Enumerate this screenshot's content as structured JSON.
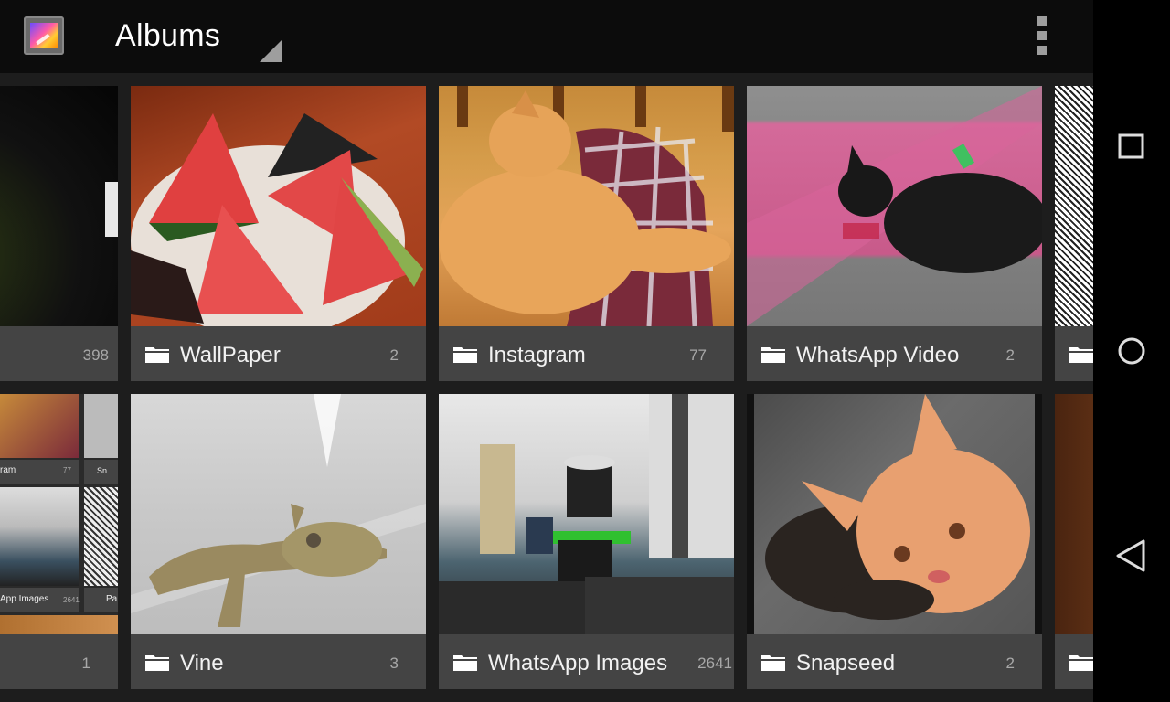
{
  "appbar": {
    "app_icon": "gallery-app-icon",
    "title": "Albums",
    "menu_icon": "overflow-menu-icon"
  },
  "albums_row1": [
    {
      "name": "",
      "count": "398"
    },
    {
      "name": "WallPaper",
      "count": "2"
    },
    {
      "name": "Instagram",
      "count": "77"
    },
    {
      "name": "WhatsApp Video",
      "count": "2"
    },
    {
      "name": "",
      "count": ""
    }
  ],
  "albums_row2": [
    {
      "name": "",
      "count": "1"
    },
    {
      "name": "Vine",
      "count": "3"
    },
    {
      "name": "WhatsApp Images",
      "count": "2641"
    },
    {
      "name": "Snapseed",
      "count": "2"
    },
    {
      "name": "",
      "count": ""
    }
  ],
  "collage": {
    "label_a": "ram",
    "count_a": "77",
    "label_b": "Sn",
    "label_c": "App Images",
    "count_c": "2641",
    "label_d": "Pa"
  },
  "navbar": {
    "recents_icon": "square-recents-icon",
    "home_icon": "circle-home-icon",
    "back_icon": "triangle-back-icon"
  },
  "colors": {
    "appbar_bg": "#0c0c0c",
    "label_bg": "#444444",
    "grid_bg": "#1d1d1d",
    "navbar_bg": "#000000"
  }
}
